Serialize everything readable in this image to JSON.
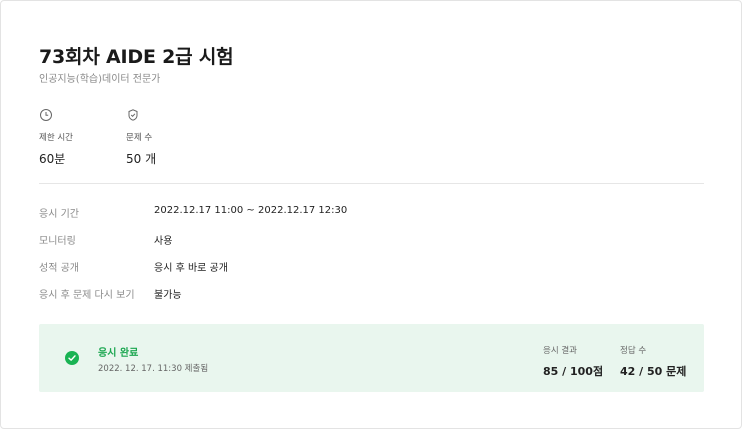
{
  "exam": {
    "title": "73회차 AIDE 2급 시험",
    "subtitle": "인공지능(학습)데이터 전문가"
  },
  "meta": {
    "time_icon": "clock-icon",
    "time_label": "제한 시간",
    "time_value": "60분",
    "count_icon": "shield-check-icon",
    "count_label": "문제 수",
    "count_value": "50 개"
  },
  "info": [
    {
      "label": "응시 기간",
      "value": "2022.12.17 11:00 ~ 2022.12.17 12:30"
    },
    {
      "label": "모니터링",
      "value": "사용"
    },
    {
      "label": "성적 공개",
      "value": "응시 후 바로 공개"
    },
    {
      "label": "응시 후 문제 다시 보기",
      "value": "불가능"
    }
  ],
  "result": {
    "status": "응시 완료",
    "submitted": "2022. 12. 17. 11:30 제출됨",
    "exam_result_label": "응시 결과",
    "exam_result_value": "85 / 100점",
    "correct_label": "정답 수",
    "correct_value": "42 / 50 문제",
    "accent_color": "#19b353"
  }
}
